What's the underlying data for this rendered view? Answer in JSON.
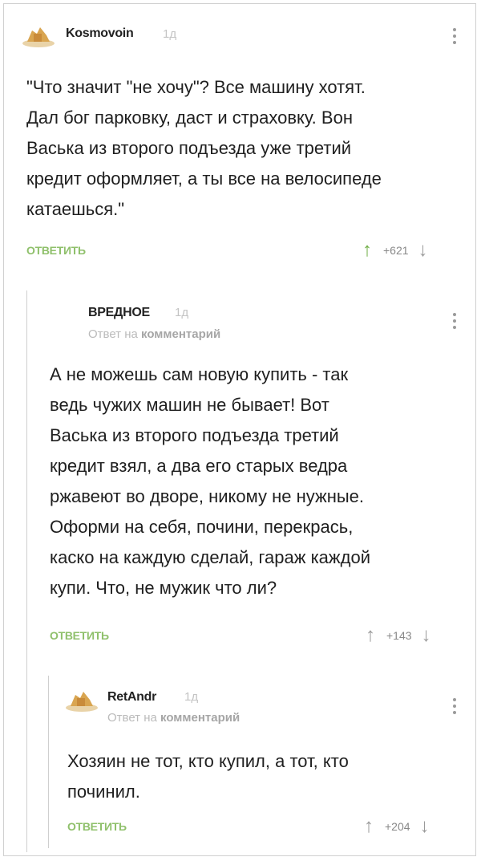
{
  "comments": [
    {
      "author": "Kosmovoin",
      "time": "1д",
      "text_lines": [
        "\"Что значит \"не хочу\"? Все машину хотят.",
        "Дал бог парковку, даст и страховку. Вон",
        "Васька из второго подъезда уже третий",
        "кредит оформляет, а ты все на велосипеде",
        "катаешься.\""
      ],
      "reply_label": "ОТВЕТИТЬ",
      "score": "+621"
    },
    {
      "author": "ВРЕДНОЕ",
      "time": "1д",
      "reply_prefix": "Ответ на",
      "reply_target": "комментарий",
      "text_lines": [
        "А не можешь сам новую купить - так",
        "ведь чужих машин не бывает! Вот",
        "Васька из второго подъезда третий",
        "кредит взял, а два его старых ведра",
        "ржавеют во дворе, никому не нужные.",
        "Оформи на себя, почини, перекрась,",
        "каско на каждую сделай, гараж каждой",
        "купи. Что, не мужик что ли?"
      ],
      "reply_label": "ОТВЕТИТЬ",
      "score": "+143"
    },
    {
      "author": "RetAndr",
      "time": "1д",
      "reply_prefix": "Ответ на",
      "reply_target": "комментарий",
      "text_lines": [
        "Хозяин не тот, кто купил, а тот, кто",
        "починил."
      ],
      "reply_label": "ОТВЕТИТЬ",
      "score": "+204"
    }
  ],
  "icons": {
    "upvote": "arrow-up-icon",
    "downvote": "arrow-down-icon",
    "menu": "more-vertical-icon"
  },
  "colors": {
    "reply_green": "#8fc06b",
    "upvote_green": "#6fae44"
  }
}
